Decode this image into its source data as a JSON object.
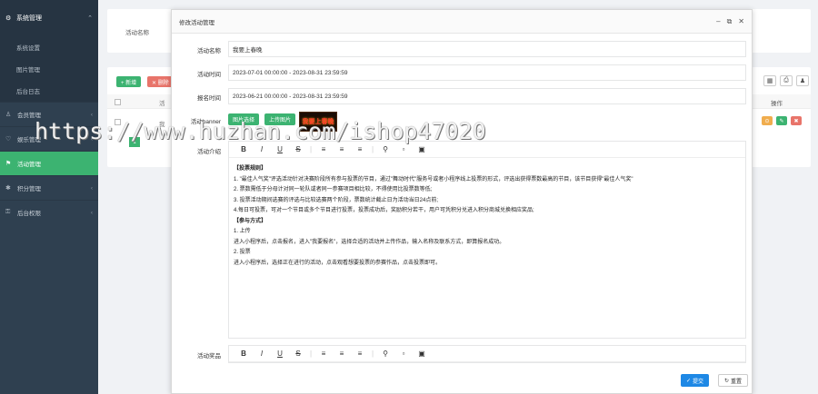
{
  "sidebar": {
    "header": {
      "icon": "gear-icon",
      "label": "系统管理"
    },
    "sub_items": [
      {
        "label": "系统设置"
      },
      {
        "label": "图片管理"
      },
      {
        "label": "后台日志"
      }
    ],
    "items": [
      {
        "icon": "user-icon",
        "label": "会员管理",
        "active": false
      },
      {
        "icon": "heart-icon",
        "label": "娱乐管理",
        "active": false
      },
      {
        "icon": "flag-icon",
        "label": "活动管理",
        "active": true
      },
      {
        "icon": "star-icon",
        "label": "积分管理",
        "active": false
      },
      {
        "icon": "lock-icon",
        "label": "后台权限",
        "active": false
      }
    ]
  },
  "background": {
    "filter_label": "活动名称",
    "add_button": "+ 新增",
    "delete_button": "✕ 删除",
    "table_col_ops": "操作",
    "page_number": "1",
    "col_cut_1": "活",
    "col_cut_2": "我",
    "accent": "#3cb371"
  },
  "modal": {
    "title": "修改活动管理",
    "fields": {
      "name": {
        "label": "活动名称",
        "value": "我要上春晚"
      },
      "time": {
        "label": "活动时间",
        "value": "2023-07-01 00:00:00 - 2023-08-31 23:59:59"
      },
      "signup": {
        "label": "报名时间",
        "value": "2023-06-21 00:00:00 - 2023-08-31 23:59:59"
      },
      "banner": {
        "label": "活动banner",
        "select_button": "图片选择",
        "upload_button": "上传图片",
        "image_text": "我要上春晚"
      },
      "intro": {
        "label": "活动介绍"
      },
      "prize": {
        "label": "活动奖品"
      }
    },
    "intro_content": [
      "【投票规则】",
      "1. \"最佳人气奖\"评选活动针对决赛阶段所有参与投票的节目，通过\"舞动时代\"服务号或者小程序线上投票的形式，评选出获得票数最高的节目，该节目获得\"最佳人气奖\"",
      "2. 票数需低于分母计对同一轮队或者同一参赛项目相比较，不得使用比投票数等低;",
      "3. 投票活动期间选赛的评选与比较选赛两个阶段，票数统计截止日为活动当日24点前;",
      "4.每日可投票，可对一个节目或多个节目进行投票，投票成功后，奖励积分若干，用户可凭积分兑进入积分商城兑换相应奖品;",
      "【参与方式】",
      "1. 上传",
      "进入小程序后，点击报名，进入\"我要报名\"，选择合适的活动并上传作品，输入名称及联系方式，即算报名成功。",
      "2. 投票",
      "进入小程序后，选择正在进行的活动，点击观看想要投票的参赛作品，点击投票即可。"
    ],
    "submit_button": "提交",
    "reset_button": "重置"
  },
  "watermark": "https://www.huzhan.com/ishop47020"
}
